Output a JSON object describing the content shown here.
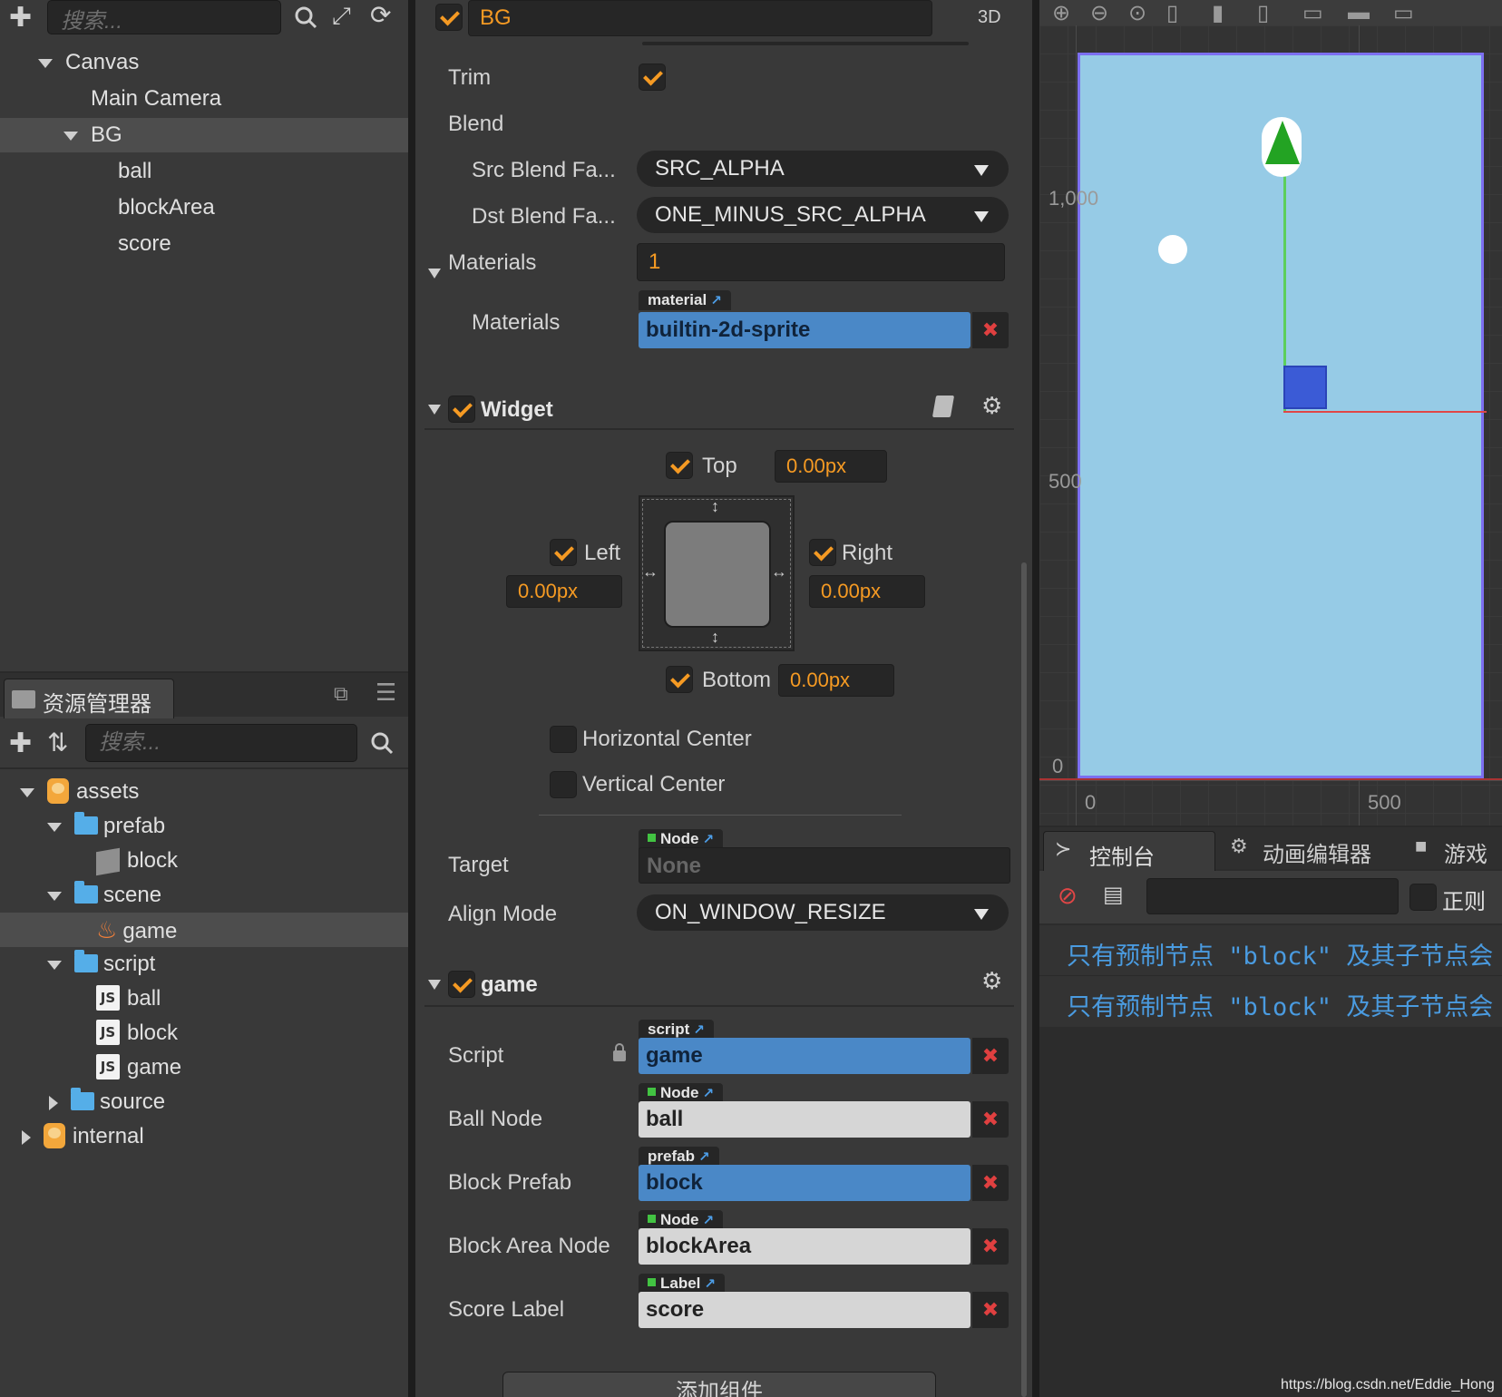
{
  "hierarchy": {
    "search_placeholder": "搜索...",
    "nodes": [
      {
        "label": "Canvas"
      },
      {
        "label": "Main Camera"
      },
      {
        "label": "BG"
      },
      {
        "label": "ball"
      },
      {
        "label": "blockArea"
      },
      {
        "label": "score"
      }
    ]
  },
  "assets": {
    "tab_title": "资源管理器",
    "search_placeholder": "搜索...",
    "items": [
      {
        "label": "assets"
      },
      {
        "label": "prefab"
      },
      {
        "label": "block"
      },
      {
        "label": "scene"
      },
      {
        "label": "game"
      },
      {
        "label": "script"
      },
      {
        "label": "ball"
      },
      {
        "label": "block"
      },
      {
        "label": "game"
      },
      {
        "label": "source"
      },
      {
        "label": "internal"
      }
    ],
    "js_badge": "JS"
  },
  "inspector": {
    "node_name": "BG",
    "mode_3d": "3D",
    "trim_label": "Trim",
    "blend_label": "Blend",
    "src_blend_label": "Src Blend Fa...",
    "src_blend_value": "SRC_ALPHA",
    "dst_blend_label": "Dst Blend Fa...",
    "dst_blend_value": "ONE_MINUS_SRC_ALPHA",
    "materials_label": "Materials",
    "materials_count": "1",
    "material_tag": "material",
    "materials_item_label": "Materials",
    "material_value": "builtin-2d-sprite",
    "widget": {
      "title": "Widget",
      "top_label": "Top",
      "top_value": "0.00px",
      "left_label": "Left",
      "left_value": "0.00px",
      "right_label": "Right",
      "right_value": "0.00px",
      "bottom_label": "Bottom",
      "bottom_value": "0.00px",
      "hcenter_label": "Horizontal Center",
      "vcenter_label": "Vertical Center",
      "target_label": "Target",
      "target_tag": "Node",
      "target_value": "None",
      "align_mode_label": "Align Mode",
      "align_mode_value": "ON_WINDOW_RESIZE"
    },
    "game": {
      "title": "game",
      "script_label": "Script",
      "script_tag": "script",
      "script_value": "game",
      "ball_label": "Ball Node",
      "ball_tag": "Node",
      "ball_value": "ball",
      "prefab_label": "Block Prefab",
      "prefab_tag": "prefab",
      "prefab_value": "block",
      "area_label": "Block Area Node",
      "area_tag": "Node",
      "area_value": "blockArea",
      "score_label": "Score Label",
      "score_tag": "Label",
      "score_value": "score"
    },
    "add_component": "添加组件"
  },
  "scene": {
    "ruler_y": [
      "1,000",
      "500",
      "0"
    ],
    "ruler_x": [
      "0",
      "500"
    ],
    "canvas_color": "#96cbe6",
    "outline_color": "#7c6ff0"
  },
  "console": {
    "tabs": [
      "控制台",
      "动画编辑器",
      "游戏预"
    ],
    "regex_label": "正则",
    "messages": [
      "只有预制节点 \"block\" 及其子节点会",
      "只有预制节点 \"block\" 及其子节点会"
    ]
  },
  "watermark": "https://blog.csdn.net/Eddie_Hong"
}
